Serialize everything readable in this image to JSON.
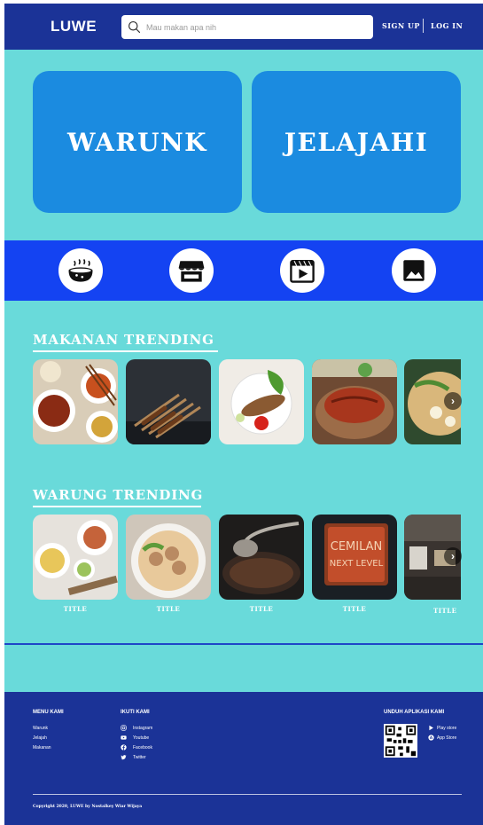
{
  "header": {
    "logo": "LUWE",
    "search_placeholder": "Mau makan apa nih",
    "signup_label": "SIGN UP",
    "login_label": "LOG IN"
  },
  "hero": {
    "left_label": "WARUNK",
    "right_label": "JELAJAHI"
  },
  "categories": [
    {
      "icon": "food-pot-icon"
    },
    {
      "icon": "store-icon"
    },
    {
      "icon": "video-icon"
    },
    {
      "icon": "image-icon"
    }
  ],
  "trending_food": {
    "title": "MAKANAN TRENDING",
    "next_label": "›"
  },
  "trending_warung": {
    "title": "WARUNG TRENDING",
    "next_label": "›",
    "items": [
      {
        "title": "TITLE"
      },
      {
        "title": "TITLE"
      },
      {
        "title": "TITLE"
      },
      {
        "title": "TITLE"
      },
      {
        "title": "TITLE"
      }
    ],
    "sign_line1": "CEMILAN",
    "sign_line2": "NEXT LEVEL"
  },
  "footer": {
    "menu_heading": "MENU KAMI",
    "menu_items": [
      "Warunk",
      "Jelajah",
      "Makanan"
    ],
    "social_heading": "IKUTI KAMI",
    "social_items": [
      "Instagram",
      "Youtube",
      "Facebook",
      "Twitter"
    ],
    "app_heading": "UNDUH APLIKASI KAMI",
    "app_items": [
      "Play store",
      "App Store"
    ],
    "copyright": "Copyright 2020, LUWE by Nostalkey Wiar Wijaya"
  },
  "colors": {
    "page_bg": "#69dada",
    "header_bg": "#1b3397",
    "hero_card": "#1b8be0",
    "category_band": "#1443f2",
    "footer_bg": "#1b3397"
  }
}
